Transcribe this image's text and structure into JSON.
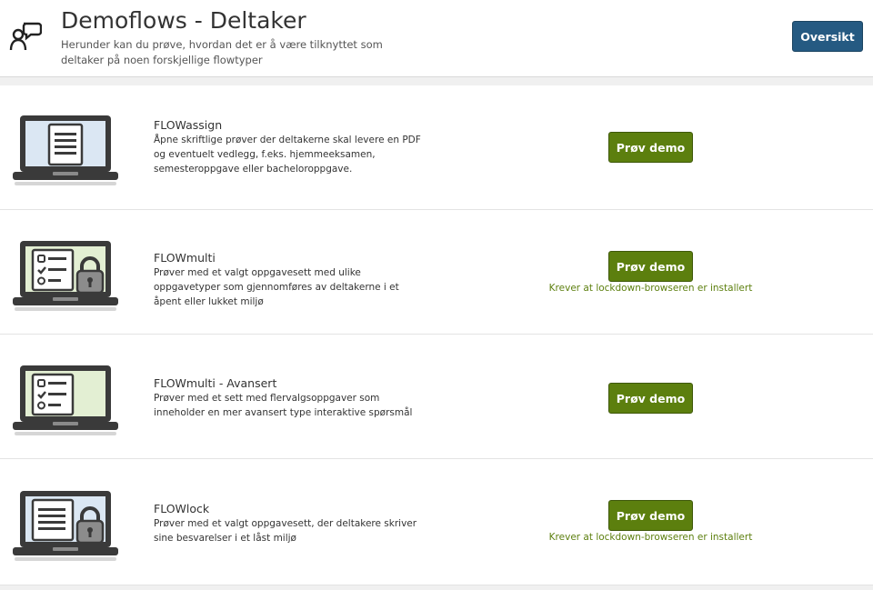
{
  "header": {
    "title": "Demoflows - Deltaker",
    "subtitle": "Herunder kan du prøve, hvordan det er å være tilknyttet som deltaker på noen forskjellige flowtyper",
    "overview_button": "Oversikt",
    "logo_icon": "participant-chat-icon"
  },
  "colors": {
    "primary_button": "#255a82",
    "demo_button": "#5c7f0e",
    "note_text": "#5c7f0e"
  },
  "flows": [
    {
      "name": "FLOWassign",
      "description": "Åpne skriftlige prøver der deltakerne skal levere en PDF og eventuelt vedlegg, f.eks. hjemmeeksamen, semesteroppgave eller bacheloroppgave.",
      "button": "Prøv demo",
      "note": "",
      "icon": "laptop-document-icon"
    },
    {
      "name": "FLOWmulti",
      "description": "Prøver med et valgt oppgavesett med ulike oppgavetyper som gjennomføres av deltakerne i et åpent eller lukket miljø",
      "button": "Prøv demo",
      "note": "Krever at lockdown-browseren er installert",
      "icon": "laptop-checklist-lock-icon"
    },
    {
      "name": "FLOWmulti - Avansert",
      "description": "Prøver med et sett med flervalgsoppgaver som inneholder en mer avansert type interaktive spørsmål",
      "button": "Prøv demo",
      "note": "",
      "icon": "laptop-checklist-icon"
    },
    {
      "name": "FLOWlock",
      "description": "Prøver med et valgt oppgavesett, der deltakere skriver sine besvarelser i et låst miljø",
      "button": "Prøv demo",
      "note": "Krever at lockdown-browseren er installert",
      "icon": "laptop-document-lock-icon"
    }
  ]
}
